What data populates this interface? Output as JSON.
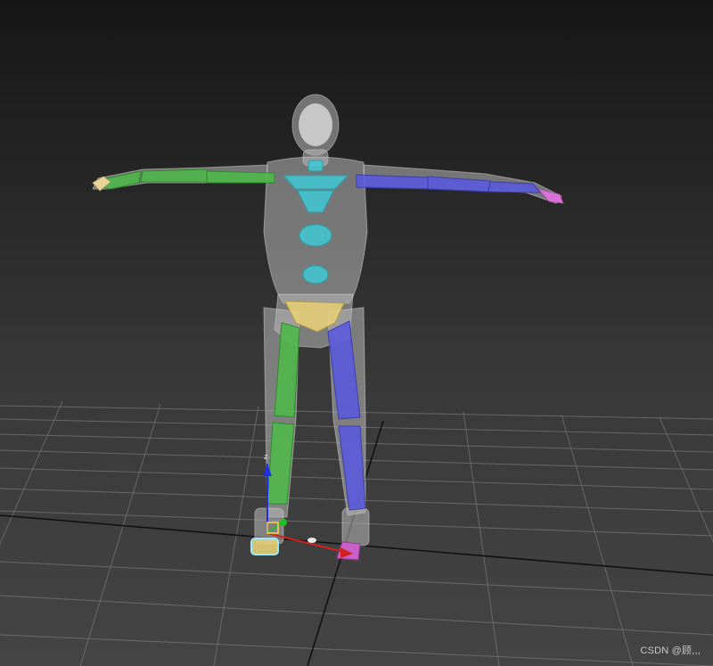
{
  "viewport": {
    "background_top": "#161616",
    "background_bottom": "#444444",
    "grid_color": "#8a8a8a",
    "grid_axis_color": "#111111"
  },
  "skeleton": {
    "left_limb_color": "#4fb84a",
    "right_limb_color": "#5b5bdc",
    "spine_color": "#3fc9d6",
    "pelvis_color": "#e6cf7a",
    "mesh_color": "#b8b8b8"
  },
  "gizmo": {
    "z_label": "z",
    "x_axis_color": "#d02020",
    "y_axis_color": "#20c020",
    "z_axis_color": "#2030e0",
    "selection_color": "#9be8ff"
  },
  "watermark": "CSDN @顾,,,"
}
